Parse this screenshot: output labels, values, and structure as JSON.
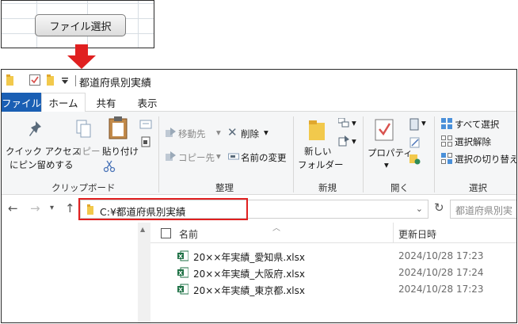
{
  "excel": {
    "button_label": "ファイル選択"
  },
  "explorer": {
    "title": "都道府県別実績",
    "tabs": [
      "ファイル",
      "ホーム",
      "共有",
      "表示"
    ],
    "ribbon": {
      "clipboard": {
        "label": "クリップボード",
        "pin_line1": "クイック アクセス",
        "pin_line2": "にピン留めする",
        "copy": "コピー",
        "paste": "貼り付け"
      },
      "organize": {
        "label": "整理",
        "move_to": "移動先",
        "copy_to": "コピー先",
        "delete": "削除",
        "rename": "名前の変更"
      },
      "new": {
        "label": "新規",
        "new_folder_line1": "新しい",
        "new_folder_line2": "フォルダー"
      },
      "open": {
        "label": "開く",
        "properties": "プロパティ"
      },
      "select": {
        "label": "選択",
        "select_all": "すべて選択",
        "select_none": "選択解除",
        "invert": "選択の切り替え"
      }
    },
    "address": {
      "path": "C:¥都道府県別実績",
      "search_placeholder": "都道府県別実"
    },
    "columns": {
      "name": "名前",
      "modified": "更新日時"
    },
    "files": [
      {
        "name": "20××年実績_愛知県.xlsx",
        "modified": "2024/10/28 17:23"
      },
      {
        "name": "20××年実績_大阪府.xlsx",
        "modified": "2024/10/28 17:24"
      },
      {
        "name": "20××年実績_東京都.xlsx",
        "modified": "2024/10/28 17:23"
      }
    ]
  },
  "colors": {
    "file_tab": "#1a5fb4",
    "highlight": "#e02020",
    "arrow": "#e02020",
    "excel_green": "#1e7145",
    "folder_yellow": "#f2c94c"
  }
}
